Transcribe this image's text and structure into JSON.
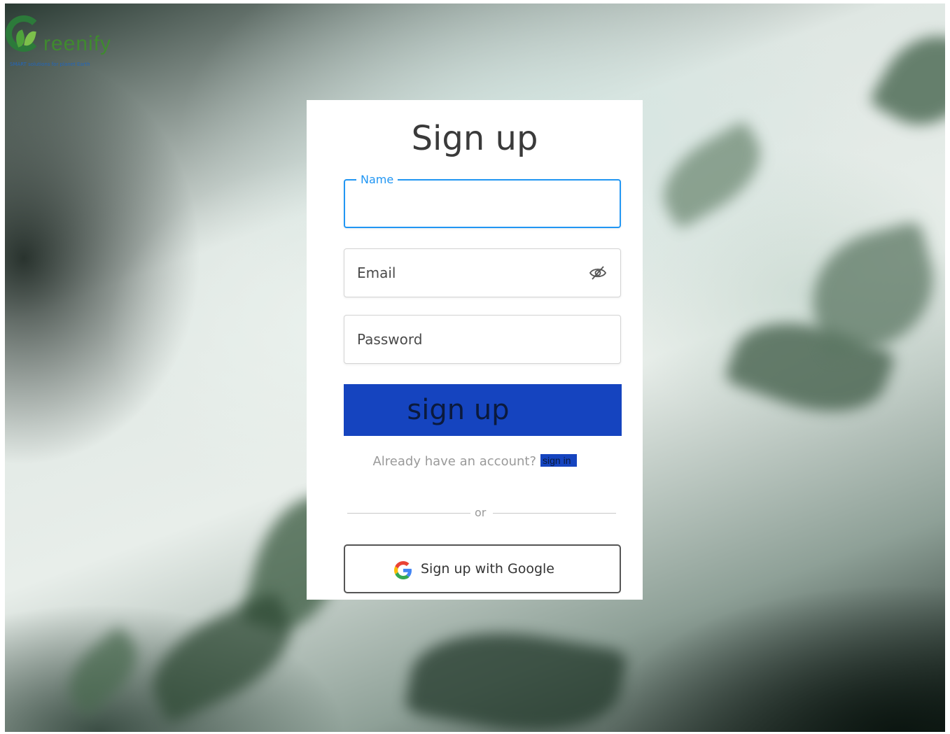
{
  "brand": {
    "name": "reenify",
    "tagline": "SMART solutions for planet Earth"
  },
  "form": {
    "title": "Sign up",
    "name_label": "Name",
    "email_placeholder": "Email",
    "password_placeholder": "Password",
    "submit_label": "sign up",
    "have_account_text": "Already have an account?",
    "signin_label": "sign in",
    "divider_text": "or",
    "google_label": "Sign up with Google"
  },
  "colors": {
    "primary": "#1544bf",
    "focus": "#2196f3",
    "brand_green": "#3f8a2f"
  },
  "icons": {
    "email_field": "eye-off-icon",
    "google": "google-icon"
  }
}
